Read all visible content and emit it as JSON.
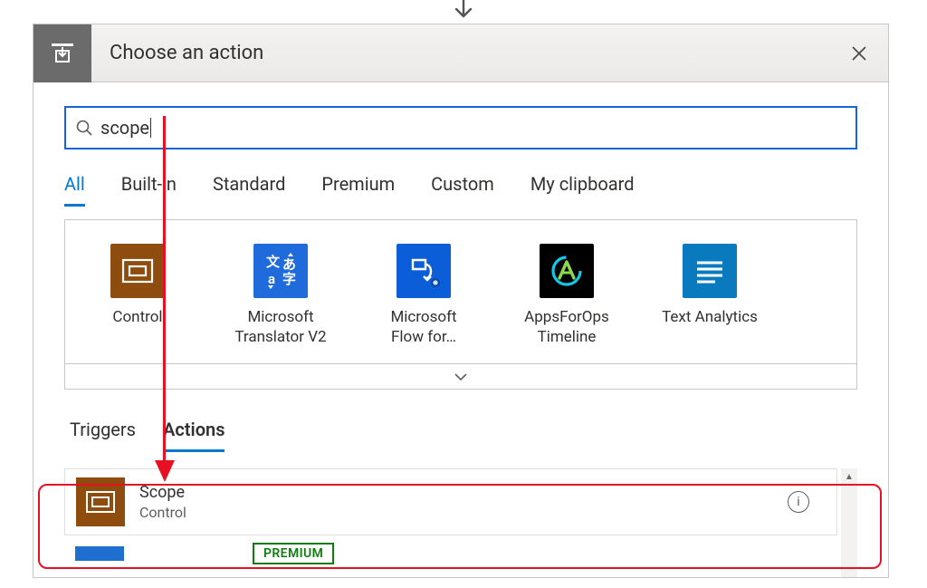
{
  "header": {
    "title": "Choose an action"
  },
  "search": {
    "value": "scope",
    "placeholder": ""
  },
  "filter_tabs": [
    "All",
    "Built-in",
    "Standard",
    "Premium",
    "Custom",
    "My clipboard"
  ],
  "filter_active_index": 0,
  "connectors": [
    {
      "name": "Control",
      "icon": "control"
    },
    {
      "name": "Microsoft\nTranslator V2",
      "icon": "translator"
    },
    {
      "name": "Microsoft\nFlow for…",
      "icon": "flow"
    },
    {
      "name": "AppsForOps\nTimeline",
      "icon": "appsforops"
    },
    {
      "name": "Text Analytics",
      "icon": "textanalytics"
    }
  ],
  "section_tabs": [
    "Triggers",
    "Actions"
  ],
  "section_active_index": 1,
  "results": [
    {
      "title": "Scope",
      "subtitle": "Control"
    }
  ],
  "premium_label": "PREMIUM"
}
